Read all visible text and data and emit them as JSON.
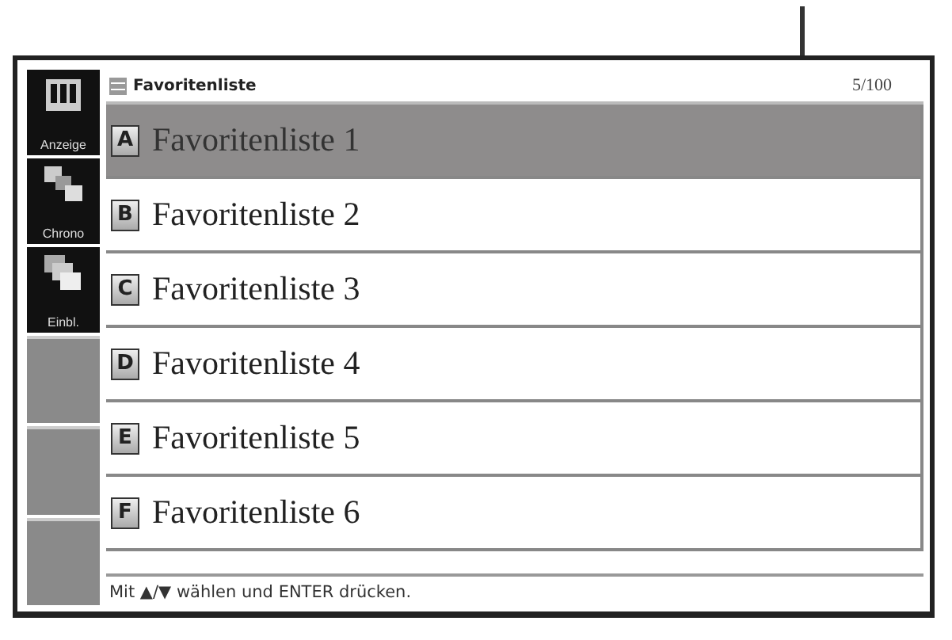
{
  "header": {
    "title": "Favoritenliste",
    "count": "5/100"
  },
  "sidebar": {
    "items": [
      {
        "label": "Anzeige",
        "kind": "all"
      },
      {
        "label": "Chrono",
        "kind": "chrono"
      },
      {
        "label": "Einbl.",
        "kind": "stack"
      }
    ]
  },
  "list": {
    "items": [
      {
        "letter": "A",
        "label": "Favoritenliste 1",
        "selected": true
      },
      {
        "letter": "B",
        "label": "Favoritenliste 2",
        "selected": false
      },
      {
        "letter": "C",
        "label": "Favoritenliste 3",
        "selected": false
      },
      {
        "letter": "D",
        "label": "Favoritenliste 4",
        "selected": false
      },
      {
        "letter": "E",
        "label": "Favoritenliste 5",
        "selected": false
      },
      {
        "letter": "F",
        "label": "Favoritenliste 6",
        "selected": false
      }
    ]
  },
  "footer": {
    "hint": "Mit ▲/▼ wählen und ENTER drücken."
  }
}
